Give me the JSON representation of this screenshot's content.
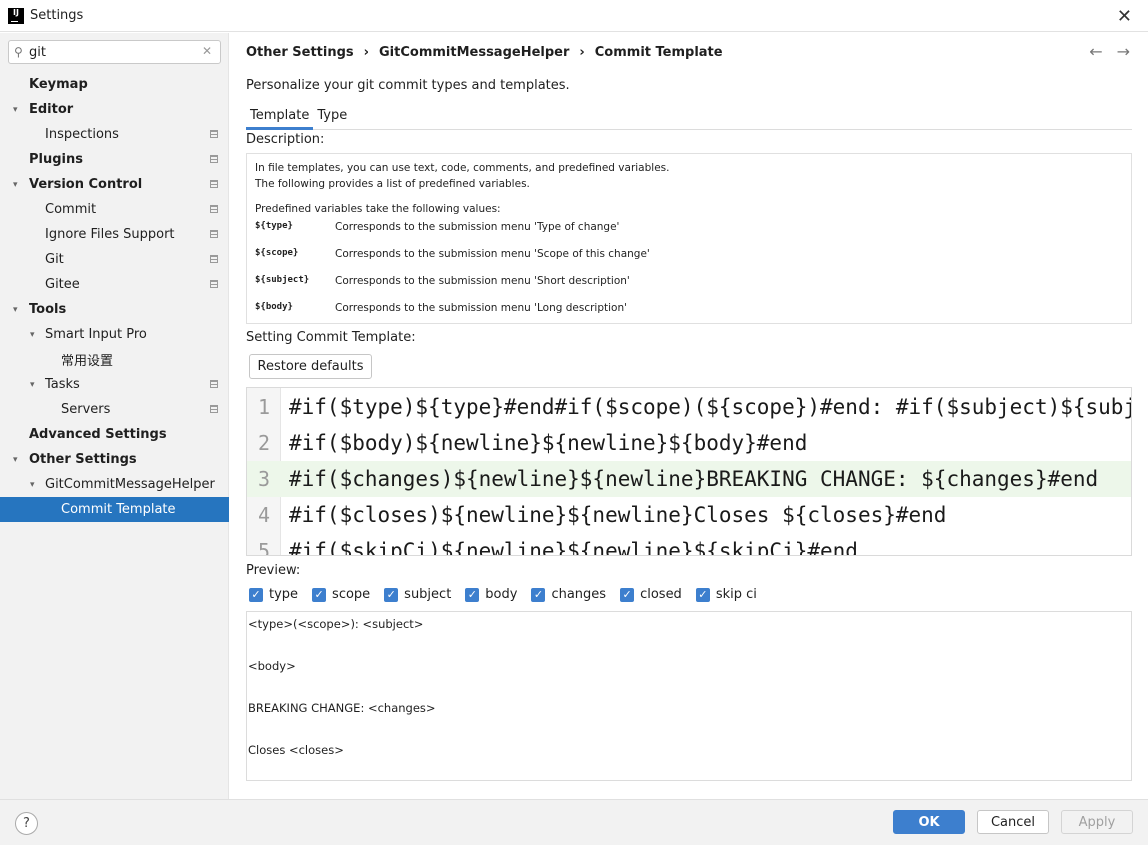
{
  "window": {
    "title": "Settings",
    "app_icon": "IJ"
  },
  "search": {
    "value": "git"
  },
  "sidebar": {
    "items": [
      {
        "label": "Keymap",
        "level": 0,
        "bold": true,
        "arrow": "",
        "mark": false
      },
      {
        "label": "Editor",
        "level": 0,
        "bold": true,
        "arrow": "down",
        "mark": false
      },
      {
        "label": "Inspections",
        "level": 1,
        "bold": false,
        "arrow": "",
        "mark": true
      },
      {
        "label": "Plugins",
        "level": 0,
        "bold": true,
        "arrow": "",
        "mark": true
      },
      {
        "label": "Version Control",
        "level": 0,
        "bold": true,
        "arrow": "down",
        "mark": true
      },
      {
        "label": "Commit",
        "level": 1,
        "bold": false,
        "arrow": "",
        "mark": true
      },
      {
        "label": "Ignore Files Support",
        "level": 1,
        "bold": false,
        "arrow": "",
        "mark": true
      },
      {
        "label": "Git",
        "level": 1,
        "bold": false,
        "arrow": "",
        "mark": true
      },
      {
        "label": "Gitee",
        "level": 1,
        "bold": false,
        "arrow": "",
        "mark": true
      },
      {
        "label": "Tools",
        "level": 0,
        "bold": true,
        "arrow": "down",
        "mark": false
      },
      {
        "label": "Smart Input Pro",
        "level": 1,
        "bold": false,
        "arrow": "down",
        "mark": false
      },
      {
        "label": "常用设置",
        "level": 2,
        "bold": false,
        "arrow": "",
        "mark": false
      },
      {
        "label": "Tasks",
        "level": 1,
        "bold": false,
        "arrow": "down",
        "mark": true
      },
      {
        "label": "Servers",
        "level": 2,
        "bold": false,
        "arrow": "",
        "mark": true
      },
      {
        "label": "Advanced Settings",
        "level": 0,
        "bold": true,
        "arrow": "",
        "mark": false
      },
      {
        "label": "Other Settings",
        "level": 0,
        "bold": true,
        "arrow": "down",
        "mark": false
      },
      {
        "label": "GitCommitMessageHelper",
        "level": 1,
        "bold": false,
        "arrow": "down",
        "mark": false
      },
      {
        "label": "Commit Template",
        "level": 2,
        "bold": false,
        "arrow": "",
        "mark": false,
        "selected": true
      }
    ]
  },
  "breadcrumb": [
    "Other Settings",
    "GitCommitMessageHelper",
    "Commit Template"
  ],
  "breadcrumb_sep": "›",
  "subtitle": "Personalize your git commit types and templates.",
  "tabs": [
    {
      "label": "Template",
      "active": true
    },
    {
      "label": "Type",
      "active": false
    }
  ],
  "description": {
    "label": "Description:",
    "intro": [
      "In file templates, you can use text, code, comments, and predefined variables.",
      "The following provides a list of predefined variables."
    ],
    "vars_heading": "Predefined variables take the following values:",
    "vars": [
      {
        "name": "${type}",
        "desc": "Corresponds to the submission menu 'Type of change'"
      },
      {
        "name": "${scope}",
        "desc": "Corresponds to the submission menu 'Scope of this change'"
      },
      {
        "name": "${subject}",
        "desc": "Corresponds to the submission menu 'Short description'"
      },
      {
        "name": "${body}",
        "desc": "Corresponds to the submission menu 'Long description'"
      }
    ]
  },
  "template_section": {
    "label": "Setting Commit Template:",
    "restore_label": "Restore defaults",
    "lines": [
      {
        "n": "1",
        "code": "#if($type)${type}#end#if($scope)(${scope})#end: #if($subject)${subject}#end",
        "hl": false
      },
      {
        "n": "2",
        "code": "#if($body)${newline}${newline}${body}#end",
        "hl": false
      },
      {
        "n": "3",
        "code": "#if($changes)${newline}${newline}BREAKING CHANGE: ${changes}#end",
        "hl": true
      },
      {
        "n": "4",
        "code": "#if($closes)${newline}${newline}Closes ${closes}#end",
        "hl": false
      },
      {
        "n": "5",
        "code": "#if($skipCi)${newline}${newline}${skipCi}#end",
        "hl": false
      }
    ]
  },
  "preview": {
    "label": "Preview:",
    "checks": [
      "type",
      "scope",
      "subject",
      "body",
      "changes",
      "closed",
      "skip ci"
    ],
    "lines": [
      "<type>(<scope>): <subject>",
      "",
      "<body>",
      "",
      "BREAKING CHANGE: <changes>",
      "",
      "Closes <closes>"
    ]
  },
  "footer": {
    "help": "?",
    "ok": "OK",
    "cancel": "Cancel",
    "apply": "Apply"
  },
  "colors": {
    "accent": "#3d7fce",
    "selection": "#2675bf",
    "highlight_line": "#edf7ea"
  }
}
